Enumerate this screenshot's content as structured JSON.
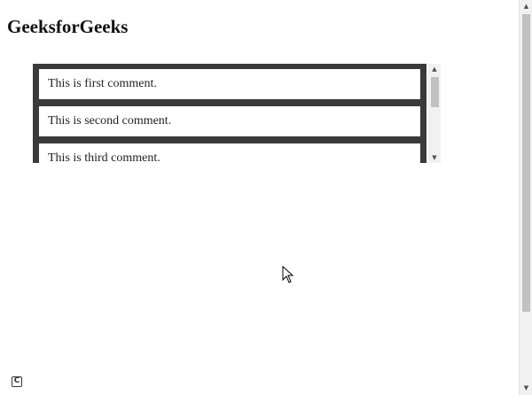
{
  "page": {
    "title": "GeeksforGeeks"
  },
  "comments": [
    "This is first comment.",
    "This is second comment.",
    "This is third comment."
  ],
  "icons": {
    "scroll_up": "scroll-up-arrow-icon",
    "scroll_down": "scroll-down-arrow-icon",
    "cursor": "mouse-pointer-icon",
    "corner": "recording-logo-icon"
  },
  "colors": {
    "list_background": "#3a3a3a",
    "item_background": "#ffffff",
    "scrollbar_thumb": "#c1c1c1"
  }
}
